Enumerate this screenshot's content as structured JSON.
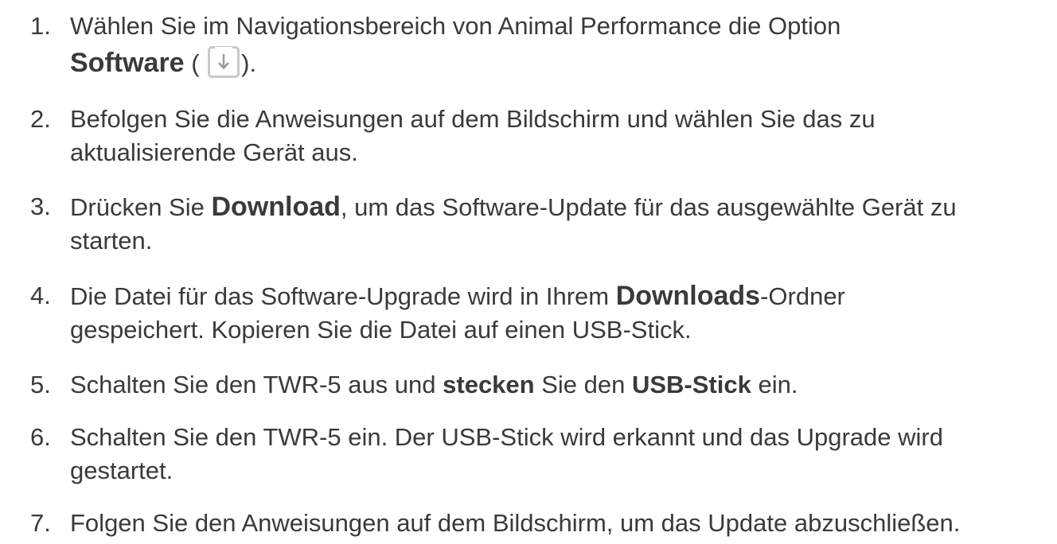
{
  "steps": [
    {
      "num": "1.",
      "line1": "Wählen Sie im Navigationsbereich von Animal Performance die Option",
      "bold": "Software",
      "paren_open": " (",
      "icon": "download-icon",
      "paren_close": ")."
    },
    {
      "num": "2.",
      "line1": "Befolgen Sie die Anweisungen auf dem Bildschirm und wählen Sie das zu",
      "line2": "aktualisierende Gerät aus."
    },
    {
      "num": "3.",
      "pre": "Drücken Sie ",
      "bold": "Download",
      "post": ", um das Software-Update für das ausgewählte Gerät zu",
      "line2": "starten."
    },
    {
      "num": "4.",
      "pre": "Die Datei für das Software-Upgrade wird in Ihrem ",
      "bold": "Downloads",
      "post": "-Ordner",
      "line2": "gespeichert. Kopieren Sie die Datei auf einen USB-Stick."
    },
    {
      "num": "5.",
      "pre": "Schalten Sie den TWR-5 aus und ",
      "bold1": "stecken",
      "mid": " Sie den ",
      "bold2": "USB-Stick",
      "post": " ein."
    },
    {
      "num": "6.",
      "line1": "Schalten Sie den TWR-5 ein. Der USB-Stick wird erkannt und das Upgrade wird",
      "line2": "gestartet."
    },
    {
      "num": "7.",
      "line1": "Folgen Sie den Anweisungen auf dem Bildschirm, um das Update abzuschließen."
    }
  ]
}
